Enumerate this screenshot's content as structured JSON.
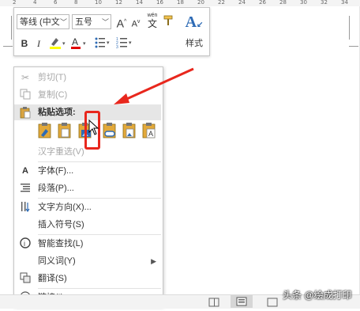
{
  "ruler": {
    "numbers": [
      "2",
      "4",
      "6",
      "8",
      "10",
      "12",
      "14",
      "16",
      "18",
      "20",
      "22",
      "24",
      "26",
      "28",
      "30",
      "32",
      "34"
    ]
  },
  "toolbar": {
    "font_name": "等线 (中文",
    "font_size": "五号",
    "grow_label": "A",
    "shrink_label": "A",
    "phonetic_label": "wén",
    "phonetic_char": "文",
    "bold": "B",
    "italic": "I",
    "font_color": "A",
    "styles_label": "样式"
  },
  "menu": {
    "cut": "剪切(T)",
    "copy": "复制(C)",
    "paste_options": "粘贴选项:",
    "reconvert": "汉字重选(V)",
    "font": "字体(F)...",
    "paragraph": "段落(P)...",
    "text_direction": "文字方向(X)...",
    "insert_symbol": "插入符号(S)",
    "smart_lookup": "智能查找(L)",
    "synonyms": "同义词(Y)",
    "translate": "翻译(S)",
    "link": "链接(I)"
  },
  "watermark": "头条 @绘成打印",
  "colors": {
    "highlight": "#ffff00",
    "font_color": "#e00000",
    "arrow": "#e8271d",
    "selected_box": "#e8271d"
  }
}
